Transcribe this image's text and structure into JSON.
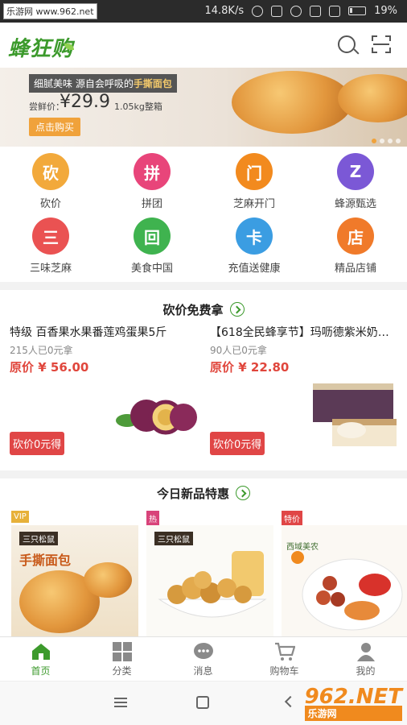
{
  "status_bar": {
    "source": "乐游网 www.962.net",
    "speed": "14.8K/s",
    "battery": "19%"
  },
  "header": {
    "logo": "蜂狂购"
  },
  "banner": {
    "tagline_prefix": "细腻美味 源自会呼吸的",
    "tagline_highlight": "手撕面包",
    "price_label": "尝鲜价：",
    "price": "¥29.9",
    "weight": "1.05kg整箱",
    "buy_label": "点击购买"
  },
  "categories": [
    {
      "label": "砍价",
      "icon": "bargain-icon",
      "glyph": "砍",
      "color": "#f2a93b"
    },
    {
      "label": "拼团",
      "icon": "group-buy-icon",
      "glyph": "拼",
      "color": "#e8457a"
    },
    {
      "label": "芝麻开门",
      "icon": "sesame-door-icon",
      "glyph": "门",
      "color": "#f28a1e"
    },
    {
      "label": "蜂源甄选",
      "icon": "selection-icon",
      "glyph": "Z",
      "color": "#7b58d6"
    },
    {
      "label": "三味芝麻",
      "icon": "three-flavor-icon",
      "glyph": "三",
      "color": "#ea5252"
    },
    {
      "label": "美食中国",
      "icon": "food-china-icon",
      "glyph": "回",
      "color": "#3fb34f"
    },
    {
      "label": "充值送健康",
      "icon": "recharge-card-icon",
      "glyph": "卡",
      "color": "#3b9de2"
    },
    {
      "label": "精品店铺",
      "icon": "store-icon",
      "glyph": "店",
      "color": "#f07a2a"
    }
  ],
  "bargain_section": {
    "title": "砍价免费拿",
    "items": [
      {
        "name": "特级 百香果水果番莲鸡蛋果5斤",
        "taken": "215人已0元拿",
        "original_price": "原价 ¥ 56.00",
        "button": "砍价0元得"
      },
      {
        "name": "【618全民蜂享节】玛呖德紫米奶…",
        "taken": "90人已0元拿",
        "original_price": "原价 ¥ 22.80",
        "button": "砍价0元得"
      }
    ]
  },
  "new_section": {
    "title": "今日新品特惠",
    "tiles": [
      {
        "ribbon": "VIP",
        "label": "手撕面包",
        "brand": "三只松鼠"
      },
      {
        "ribbon": "热",
        "label": "",
        "brand": "三只松鼠"
      },
      {
        "ribbon": "特价",
        "label": "西域美农",
        "brand": ""
      }
    ]
  },
  "bottom_nav": [
    {
      "label": "首页",
      "icon": "home-icon",
      "active": true
    },
    {
      "label": "分类",
      "icon": "category-icon",
      "active": false
    },
    {
      "label": "消息",
      "icon": "message-icon",
      "active": false
    },
    {
      "label": "购物车",
      "icon": "cart-icon",
      "active": false
    },
    {
      "label": "我的",
      "icon": "profile-icon",
      "active": false
    }
  ],
  "watermark": {
    "brand": "962.NET",
    "sub": "乐游网"
  },
  "colors": {
    "brand_green": "#3c9a2c",
    "price_red": "#e0463c",
    "button_red": "#e04646"
  }
}
